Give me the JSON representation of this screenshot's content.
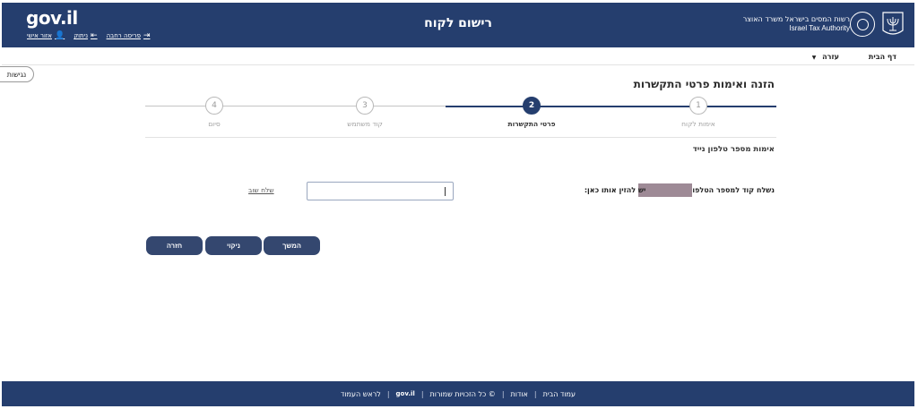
{
  "header": {
    "logo_text": "gov.il",
    "title": "רישום לקוח",
    "authority_he": "רשות המסים בישראל משרד האוצר",
    "authority_en": "Israel Tax Authority",
    "links": [
      {
        "label": "אזור אישי",
        "icon": "user-icon"
      },
      {
        "label": "ניתוק",
        "icon": "logout-icon"
      },
      {
        "label": "פריסה רחבה",
        "icon": "wide-layout-icon"
      }
    ]
  },
  "nav": {
    "home": "דף הבית",
    "help": "עזרה"
  },
  "accessibility": "נגישות",
  "page": {
    "heading": "הזנה ואימות פרטי התקשרות",
    "section_title": "אימות מספר טלפון נייד",
    "sent_prefix": "נשלח קוד למספר הטלפו",
    "sent_suffix": "יש להזין אותו כאן:",
    "resend": "שלח שוב",
    "code_value": ""
  },
  "steps": [
    {
      "number": "1",
      "label": "אימות לקוח",
      "state": "done"
    },
    {
      "number": "2",
      "label": "פרטי התקשרות",
      "state": "active"
    },
    {
      "number": "3",
      "label": "קוד משתמש",
      "state": "pending"
    },
    {
      "number": "4",
      "label": "סיום",
      "state": "pending"
    }
  ],
  "buttons": {
    "next": "המשך",
    "clear": "ניקוי",
    "back": "חזרה"
  },
  "footer": {
    "home": "עמוד הבית",
    "about": "אודות",
    "rights": "© כל הזכויות שמורות",
    "gov": "gov.il",
    "top": "לראש העמוד"
  },
  "colors": {
    "brand": "#253E6E",
    "button": "#34476F",
    "masked": "#9E8A96"
  }
}
